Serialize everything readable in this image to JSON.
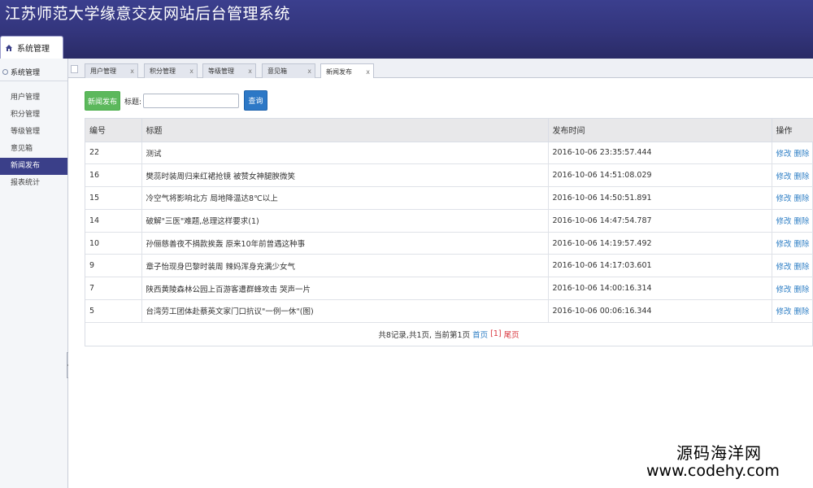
{
  "app": {
    "title": "江苏师范大学缘意交友网站后台管理系统",
    "system_tab": "系统管理"
  },
  "sidebar": {
    "group_label": "系统管理",
    "items": [
      {
        "label": "用户管理"
      },
      {
        "label": "积分管理"
      },
      {
        "label": "等级管理"
      },
      {
        "label": "意见箱"
      },
      {
        "label": "新闻发布"
      },
      {
        "label": "报表统计"
      }
    ],
    "active_index": 4
  },
  "tabs": [
    {
      "label": "用户管理",
      "close": "x"
    },
    {
      "label": "积分管理",
      "close": "x"
    },
    {
      "label": "等级管理",
      "close": "x"
    },
    {
      "label": "意见箱",
      "close": "x"
    },
    {
      "label": "新闻发布",
      "close": "x"
    }
  ],
  "toolbar": {
    "add_label": "新闻发布",
    "search_label": "标题:",
    "search_value": "",
    "query_label": "查询"
  },
  "table": {
    "headers": [
      "编号",
      "标题",
      "发布时间",
      "操作"
    ],
    "rows": [
      {
        "id": "22",
        "title": "测试",
        "time": "2016-10-06 23:35:57.444",
        "edit": "修改",
        "del": "删除"
      },
      {
        "id": "16",
        "title": "樊蕊时装周归来红裙抢镜 被赞女神腿腴微笑",
        "time": "2016-10-06 14:51:08.029",
        "edit": "修改",
        "del": "删除"
      },
      {
        "id": "15",
        "title": "冷空气将影响北方 局地降温达8℃以上",
        "time": "2016-10-06 14:50:51.891",
        "edit": "修改",
        "del": "删除"
      },
      {
        "id": "14",
        "title": "破解\"三医\"难题,总理这样要求(1)",
        "time": "2016-10-06 14:47:54.787",
        "edit": "修改",
        "del": "删除"
      },
      {
        "id": "10",
        "title": "孙俪慈善夜不捐款挨轰 原来10年前曾遇这种事",
        "time": "2016-10-06 14:19:57.492",
        "edit": "修改",
        "del": "删除"
      },
      {
        "id": "9",
        "title": "章子怡现身巴黎时装周 辣妈浑身充满少女气",
        "time": "2016-10-06 14:17:03.601",
        "edit": "修改",
        "del": "删除"
      },
      {
        "id": "7",
        "title": "陕西黄陵森林公园上百游客遭群蜂攻击 哭声一片",
        "time": "2016-10-06 14:00:16.314",
        "edit": "修改",
        "del": "删除"
      },
      {
        "id": "5",
        "title": "台湾劳工团体赴蔡英文家门口抗议\"一例一休\"(图)",
        "time": "2016-10-06 00:06:16.344",
        "edit": "修改",
        "del": "删除"
      }
    ]
  },
  "pager": {
    "summary": "共8记录,共1页, 当前第1页",
    "first": "首页",
    "current": "[1]",
    "last": "尾页"
  },
  "watermark": {
    "line1": "源码海洋网",
    "line2": "www.codehy.com"
  }
}
